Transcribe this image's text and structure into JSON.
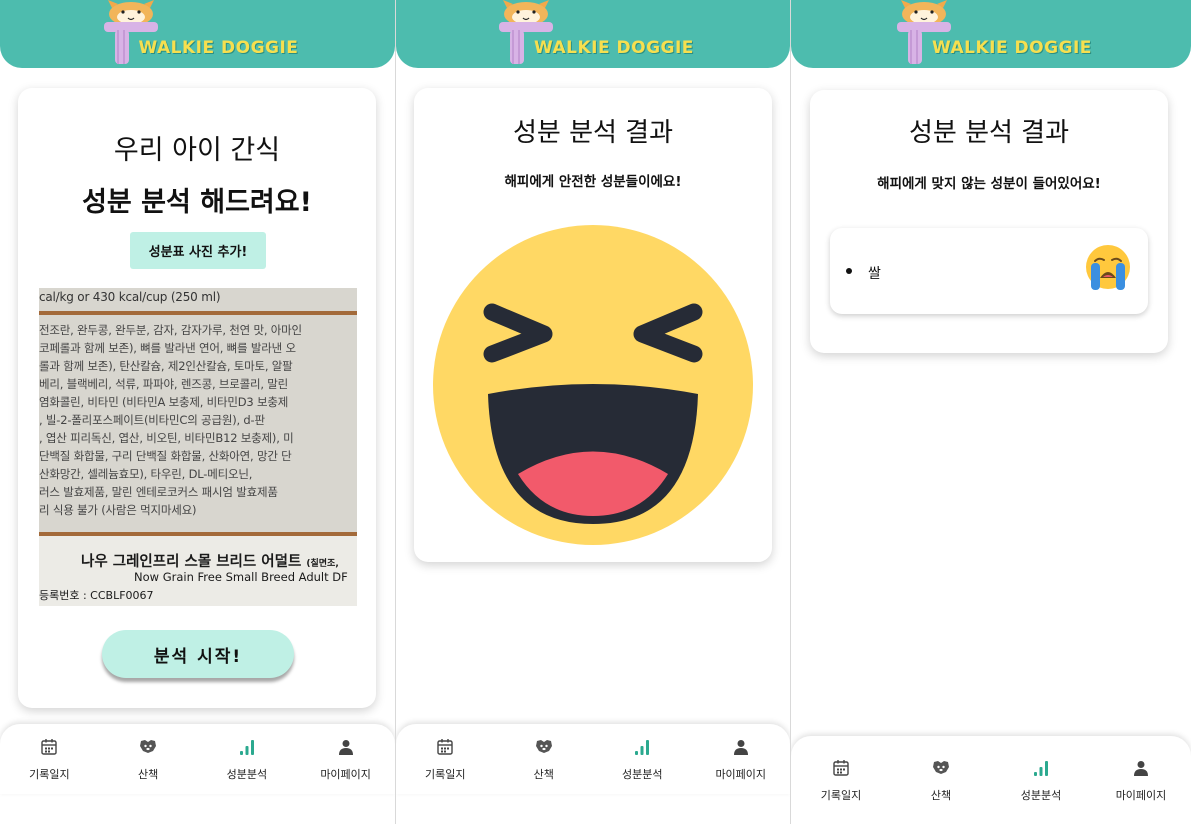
{
  "app": {
    "logo_text": "WALKIE DOGGIE",
    "brand_color": "#4dbcae",
    "accent_color": "#bff0e5"
  },
  "nav": {
    "items": [
      {
        "label": "기록일지",
        "icon": "calendar-icon"
      },
      {
        "label": "산책",
        "icon": "dog-icon"
      },
      {
        "label": "성분분석",
        "icon": "chart-icon",
        "active": true
      },
      {
        "label": "마이페이지",
        "icon": "user-icon"
      }
    ]
  },
  "screen1": {
    "title_line1": "우리 아이 간식",
    "title_line2": "성분 분석 해드려요!",
    "add_photo_label": "성분표 사진 추가!",
    "start_label": "분석 시작!",
    "photo": {
      "top_text": "cal/kg or 430 kcal/cup (250 ml)",
      "lines": [
        "전조란, 완두콩, 완두분, 감자, 감자가루, 천연 맛, 아마인",
        "코페롤과 함께 보존), 뼈를 발라낸 연어, 뼈를 발라낸 오",
        "롤과 함께 보존), 탄산칼슘, 제2인산칼슘, 토마토, 알팔",
        "베리, 블랙베리, 석류, 파파야, 렌즈콩, 브로콜리, 말린",
        "염화콜린, 비타민 (비타민A 보충제, 비타민D3 보충제",
        ", 빌-2-폴리포스페이트(비타민C의 공급원), d-판",
        ", 엽산 피리독신, 엽산, 비오틴, 비타민B12 보충제), 미",
        "단백질 화합물, 구리 단백질 화합물, 산화아연, 망간 단",
        "산화망간, 셀레늄효모), 타우린, DL-메티오닌,",
        "러스 발효제품, 말린 엔테로코커스 패시엄 발효제품",
        "리 식용 불가 (사람은 먹지마세요)"
      ],
      "product_kr": "나우 그레인프리 스몰 브리드 어덜트",
      "product_kr_suffix": "(칠면조,",
      "product_en": "Now Grain Free Small Breed Adult DF",
      "registration": "등록번호 : CCBLF0067"
    }
  },
  "screen2": {
    "title": "성분 분석 결과",
    "subtitle": "해피에게 안전한 성분들이에요!",
    "emoji": "laughing-face-icon"
  },
  "screen3": {
    "title": "성분 분석 결과",
    "subtitle": "해피에게 맞지 않는 성분이 들어있어요!",
    "items": [
      {
        "name": "쌀",
        "emoji": "crying-face-icon"
      }
    ]
  }
}
